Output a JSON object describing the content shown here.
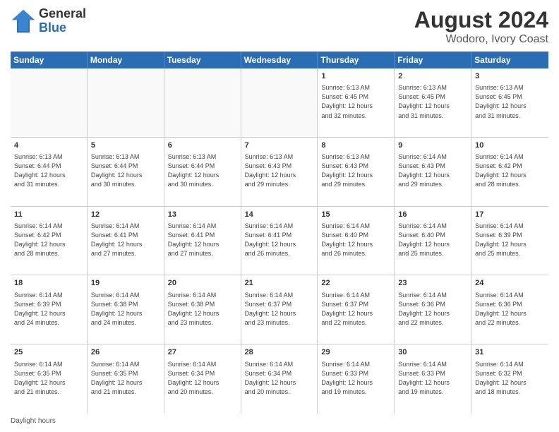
{
  "header": {
    "logo_general": "General",
    "logo_blue": "Blue",
    "title": "August 2024",
    "location": "Wodoro, Ivory Coast"
  },
  "days_of_week": [
    "Sunday",
    "Monday",
    "Tuesday",
    "Wednesday",
    "Thursday",
    "Friday",
    "Saturday"
  ],
  "footer": "Daylight hours",
  "weeks": [
    [
      {
        "day": "",
        "empty": true
      },
      {
        "day": "",
        "empty": true
      },
      {
        "day": "",
        "empty": true
      },
      {
        "day": "",
        "empty": true
      },
      {
        "day": "1",
        "lines": [
          "Sunrise: 6:13 AM",
          "Sunset: 6:45 PM",
          "Daylight: 12 hours",
          "and 32 minutes."
        ]
      },
      {
        "day": "2",
        "lines": [
          "Sunrise: 6:13 AM",
          "Sunset: 6:45 PM",
          "Daylight: 12 hours",
          "and 31 minutes."
        ]
      },
      {
        "day": "3",
        "lines": [
          "Sunrise: 6:13 AM",
          "Sunset: 6:45 PM",
          "Daylight: 12 hours",
          "and 31 minutes."
        ]
      }
    ],
    [
      {
        "day": "4",
        "lines": [
          "Sunrise: 6:13 AM",
          "Sunset: 6:44 PM",
          "Daylight: 12 hours",
          "and 31 minutes."
        ]
      },
      {
        "day": "5",
        "lines": [
          "Sunrise: 6:13 AM",
          "Sunset: 6:44 PM",
          "Daylight: 12 hours",
          "and 30 minutes."
        ]
      },
      {
        "day": "6",
        "lines": [
          "Sunrise: 6:13 AM",
          "Sunset: 6:44 PM",
          "Daylight: 12 hours",
          "and 30 minutes."
        ]
      },
      {
        "day": "7",
        "lines": [
          "Sunrise: 6:13 AM",
          "Sunset: 6:43 PM",
          "Daylight: 12 hours",
          "and 29 minutes."
        ]
      },
      {
        "day": "8",
        "lines": [
          "Sunrise: 6:13 AM",
          "Sunset: 6:43 PM",
          "Daylight: 12 hours",
          "and 29 minutes."
        ]
      },
      {
        "day": "9",
        "lines": [
          "Sunrise: 6:14 AM",
          "Sunset: 6:43 PM",
          "Daylight: 12 hours",
          "and 29 minutes."
        ]
      },
      {
        "day": "10",
        "lines": [
          "Sunrise: 6:14 AM",
          "Sunset: 6:42 PM",
          "Daylight: 12 hours",
          "and 28 minutes."
        ]
      }
    ],
    [
      {
        "day": "11",
        "lines": [
          "Sunrise: 6:14 AM",
          "Sunset: 6:42 PM",
          "Daylight: 12 hours",
          "and 28 minutes."
        ]
      },
      {
        "day": "12",
        "lines": [
          "Sunrise: 6:14 AM",
          "Sunset: 6:41 PM",
          "Daylight: 12 hours",
          "and 27 minutes."
        ]
      },
      {
        "day": "13",
        "lines": [
          "Sunrise: 6:14 AM",
          "Sunset: 6:41 PM",
          "Daylight: 12 hours",
          "and 27 minutes."
        ]
      },
      {
        "day": "14",
        "lines": [
          "Sunrise: 6:14 AM",
          "Sunset: 6:41 PM",
          "Daylight: 12 hours",
          "and 26 minutes."
        ]
      },
      {
        "day": "15",
        "lines": [
          "Sunrise: 6:14 AM",
          "Sunset: 6:40 PM",
          "Daylight: 12 hours",
          "and 26 minutes."
        ]
      },
      {
        "day": "16",
        "lines": [
          "Sunrise: 6:14 AM",
          "Sunset: 6:40 PM",
          "Daylight: 12 hours",
          "and 25 minutes."
        ]
      },
      {
        "day": "17",
        "lines": [
          "Sunrise: 6:14 AM",
          "Sunset: 6:39 PM",
          "Daylight: 12 hours",
          "and 25 minutes."
        ]
      }
    ],
    [
      {
        "day": "18",
        "lines": [
          "Sunrise: 6:14 AM",
          "Sunset: 6:39 PM",
          "Daylight: 12 hours",
          "and 24 minutes."
        ]
      },
      {
        "day": "19",
        "lines": [
          "Sunrise: 6:14 AM",
          "Sunset: 6:38 PM",
          "Daylight: 12 hours",
          "and 24 minutes."
        ]
      },
      {
        "day": "20",
        "lines": [
          "Sunrise: 6:14 AM",
          "Sunset: 6:38 PM",
          "Daylight: 12 hours",
          "and 23 minutes."
        ]
      },
      {
        "day": "21",
        "lines": [
          "Sunrise: 6:14 AM",
          "Sunset: 6:37 PM",
          "Daylight: 12 hours",
          "and 23 minutes."
        ]
      },
      {
        "day": "22",
        "lines": [
          "Sunrise: 6:14 AM",
          "Sunset: 6:37 PM",
          "Daylight: 12 hours",
          "and 22 minutes."
        ]
      },
      {
        "day": "23",
        "lines": [
          "Sunrise: 6:14 AM",
          "Sunset: 6:36 PM",
          "Daylight: 12 hours",
          "and 22 minutes."
        ]
      },
      {
        "day": "24",
        "lines": [
          "Sunrise: 6:14 AM",
          "Sunset: 6:36 PM",
          "Daylight: 12 hours",
          "and 22 minutes."
        ]
      }
    ],
    [
      {
        "day": "25",
        "lines": [
          "Sunrise: 6:14 AM",
          "Sunset: 6:35 PM",
          "Daylight: 12 hours",
          "and 21 minutes."
        ]
      },
      {
        "day": "26",
        "lines": [
          "Sunrise: 6:14 AM",
          "Sunset: 6:35 PM",
          "Daylight: 12 hours",
          "and 21 minutes."
        ]
      },
      {
        "day": "27",
        "lines": [
          "Sunrise: 6:14 AM",
          "Sunset: 6:34 PM",
          "Daylight: 12 hours",
          "and 20 minutes."
        ]
      },
      {
        "day": "28",
        "lines": [
          "Sunrise: 6:14 AM",
          "Sunset: 6:34 PM",
          "Daylight: 12 hours",
          "and 20 minutes."
        ]
      },
      {
        "day": "29",
        "lines": [
          "Sunrise: 6:14 AM",
          "Sunset: 6:33 PM",
          "Daylight: 12 hours",
          "and 19 minutes."
        ]
      },
      {
        "day": "30",
        "lines": [
          "Sunrise: 6:14 AM",
          "Sunset: 6:33 PM",
          "Daylight: 12 hours",
          "and 19 minutes."
        ]
      },
      {
        "day": "31",
        "lines": [
          "Sunrise: 6:14 AM",
          "Sunset: 6:32 PM",
          "Daylight: 12 hours",
          "and 18 minutes."
        ]
      }
    ]
  ]
}
